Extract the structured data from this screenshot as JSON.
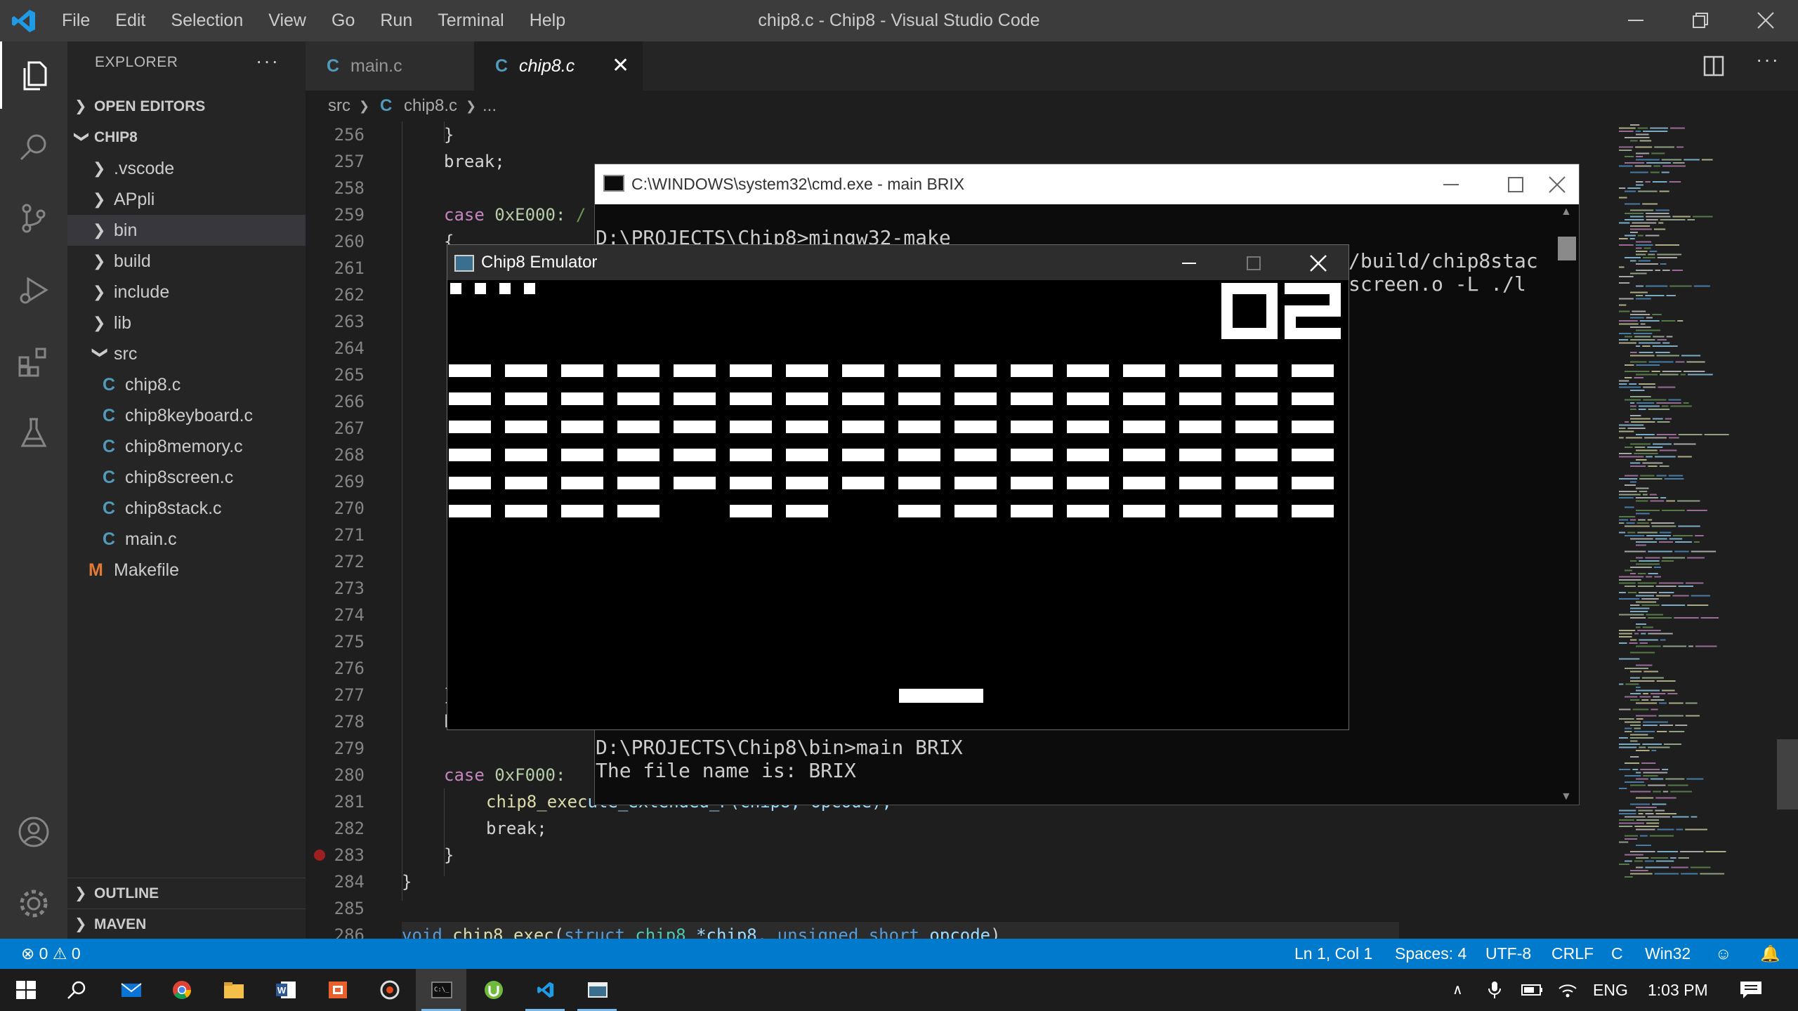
{
  "window": {
    "title": "chip8.c - Chip8 - Visual Studio Code"
  },
  "menu": [
    "File",
    "Edit",
    "Selection",
    "View",
    "Go",
    "Run",
    "Terminal",
    "Help"
  ],
  "sidebar": {
    "title": "EXPLORER",
    "more": "···",
    "open_editors": "OPEN EDITORS",
    "project": "CHIP8",
    "items": [
      {
        "label": ".vscode",
        "type": "folder",
        "expanded": false
      },
      {
        "label": "APpli",
        "type": "folder",
        "expanded": false
      },
      {
        "label": "bin",
        "type": "folder",
        "expanded": false,
        "selected": true
      },
      {
        "label": "build",
        "type": "folder",
        "expanded": false
      },
      {
        "label": "include",
        "type": "folder",
        "expanded": false
      },
      {
        "label": "lib",
        "type": "folder",
        "expanded": false
      },
      {
        "label": "src",
        "type": "folder",
        "expanded": true
      },
      {
        "label": "chip8.c",
        "type": "c",
        "icon": "C"
      },
      {
        "label": "chip8keyboard.c",
        "type": "c",
        "icon": "C"
      },
      {
        "label": "chip8memory.c",
        "type": "c",
        "icon": "C"
      },
      {
        "label": "chip8screen.c",
        "type": "c",
        "icon": "C"
      },
      {
        "label": "chip8stack.c",
        "type": "c",
        "icon": "C"
      },
      {
        "label": "main.c",
        "type": "c",
        "icon": "C"
      },
      {
        "label": "Makefile",
        "type": "makefile",
        "icon": "M"
      }
    ],
    "outline": "OUTLINE",
    "maven": "MAVEN"
  },
  "tabs": [
    {
      "label": "main.c",
      "icon": "C",
      "active": false
    },
    {
      "label": "chip8.c",
      "icon": "C",
      "active": true,
      "close": "✕"
    }
  ],
  "breadcrumb": {
    "folder": "src",
    "file_icon": "C",
    "file": "chip8.c",
    "tail": "..."
  },
  "code": {
    "line_numbers": [
      "256",
      "257",
      "258",
      "259",
      "260",
      "261",
      "262",
      "263",
      "264",
      "265",
      "266",
      "267",
      "268",
      "269",
      "270",
      "271",
      "272",
      "273",
      "274",
      "275",
      "276",
      "277",
      "278",
      "279",
      "280",
      "281",
      "282",
      "283",
      "284",
      "285",
      "286"
    ],
    "lines": {
      "l256": "}",
      "l257": "break;",
      "l259_kw": "case",
      "l259_num": "0xE000:",
      "l259_cm": "/",
      "l260": "{",
      "l277": "}",
      "l278": "b",
      "l280_kw": "case",
      "l280_num": "0xF000:",
      "l281_fn": "chip8_exec",
      "l281_rest": "ute_extended_F(chip8, opcode);",
      "l282": "break;",
      "l283": "}",
      "l284": "}",
      "l286_kw1": "void",
      "l286_fn": "chip8_exec",
      "l286_p1": "(",
      "l286_kw2": "struct",
      "l286_t": "chip8",
      "l286_v": "*chip8",
      "l286_c": ",",
      "l286_kw3": "unsigned short",
      "l286_v2": "opcode",
      "l286_e": ")"
    }
  },
  "cmd": {
    "title": "C:\\WINDOWS\\system32\\cmd.exe - main  BRIX",
    "lines": [
      "D:\\PROJECTS\\Chip8>mingw32-make",
      "/build/chip8stac",
      "screen.o -L ./l",
      "D:\\PROJECTS\\Chip8\\bin>main BRIX",
      "The file name is: BRIX"
    ]
  },
  "chip8": {
    "title": "Chip8 Emulator",
    "lives": 4,
    "score": "02",
    "brick_rows": 6,
    "brick_cols": 16,
    "missing_bricks": [
      [
        5,
        4
      ],
      [
        5,
        7
      ]
    ]
  },
  "statusbar": {
    "errors": "0",
    "warnings": "0",
    "position": "Ln 1, Col 1",
    "spaces": "Spaces: 4",
    "encoding": "UTF-8",
    "eol": "CRLF",
    "language": "C",
    "platform": "Win32"
  },
  "taskbar": {
    "apps": [
      "start-icon",
      "search-icon",
      "mail-icon",
      "chrome-icon",
      "file-explorer-icon",
      "word-icon",
      "office-icon",
      "media-player-icon",
      "terminal-icon",
      "utorrent-icon",
      "vscode-icon",
      "chip8-app-icon"
    ],
    "language": "ENG",
    "time": "1:03 PM"
  },
  "colors": {
    "titlebar": "#3c3c3c",
    "activitybar": "#333333",
    "sidebar": "#252526",
    "editor": "#1e1e1e",
    "statusbar": "#007acc",
    "taskbar": "#1c1c1c",
    "c_icon": "#519aba",
    "makefile_icon": "#e37933"
  }
}
